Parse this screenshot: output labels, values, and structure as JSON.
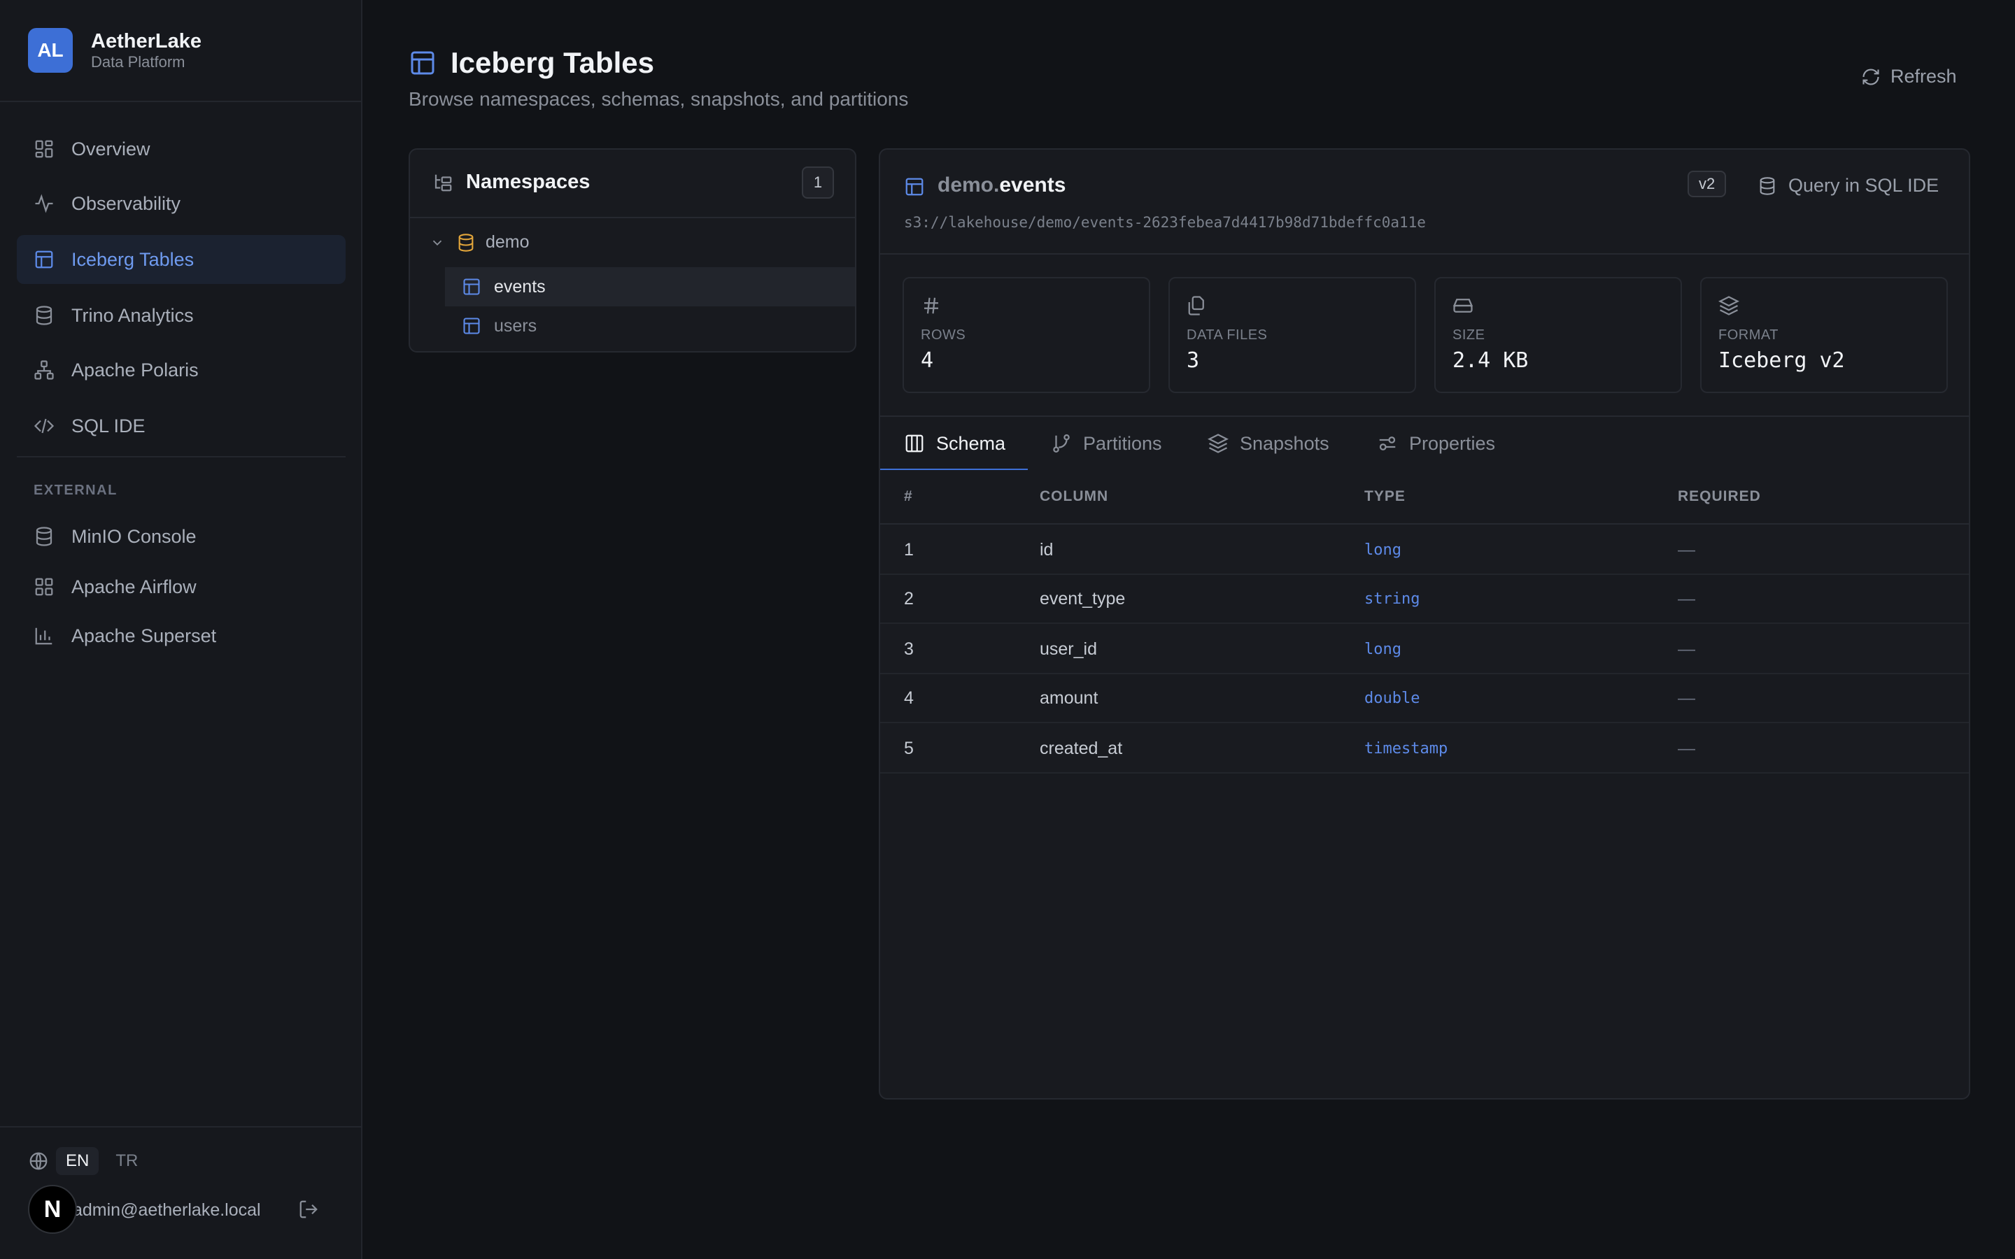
{
  "brand": {
    "logo": "AL",
    "name": "AetherLake",
    "subtitle": "Data Platform"
  },
  "nav": {
    "items": [
      {
        "label": "Overview",
        "icon": "grid-icon"
      },
      {
        "label": "Observability",
        "icon": "activity-icon"
      },
      {
        "label": "Iceberg Tables",
        "icon": "table-icon",
        "active": true
      },
      {
        "label": "Trino Analytics",
        "icon": "database-icon"
      },
      {
        "label": "Apache Polaris",
        "icon": "network-icon"
      },
      {
        "label": "SQL IDE",
        "icon": "code-icon"
      }
    ],
    "external_label": "EXTERNAL",
    "external": [
      {
        "label": "MinIO Console",
        "icon": "database-icon"
      },
      {
        "label": "Apache Airflow",
        "icon": "grid-icon"
      },
      {
        "label": "Apache Superset",
        "icon": "bar-chart-icon"
      }
    ]
  },
  "footer": {
    "languages": [
      "EN",
      "TR"
    ],
    "active_language": "EN",
    "user_email": "admin@aetherlake.local",
    "avatar_letter": "N"
  },
  "header": {
    "title": "Iceberg Tables",
    "subtitle": "Browse namespaces, schemas, snapshots, and partitions",
    "refresh_label": "Refresh"
  },
  "namespaces": {
    "title": "Namespaces",
    "count": "1",
    "tree": {
      "namespace": "demo",
      "tables": [
        "events",
        "users"
      ],
      "selected": "events"
    }
  },
  "table": {
    "namespace": "demo",
    "separator": ".",
    "name": "events",
    "location": "s3://lakehouse/demo/events-2623febea7d4417b98d71bdeffc0a11e",
    "version_badge": "v2",
    "query_label": "Query in SQL IDE",
    "stats": [
      {
        "label": "ROWS",
        "value": "4",
        "icon": "hash-icon"
      },
      {
        "label": "DATA FILES",
        "value": "3",
        "icon": "files-icon"
      },
      {
        "label": "SIZE",
        "value": "2.4 KB",
        "icon": "hard-drive-icon"
      },
      {
        "label": "FORMAT",
        "value": "Iceberg v2",
        "icon": "layers-icon"
      }
    ],
    "tabs": [
      {
        "label": "Schema",
        "icon": "columns-icon",
        "active": true
      },
      {
        "label": "Partitions",
        "icon": "git-branch-icon"
      },
      {
        "label": "Snapshots",
        "icon": "layers-icon"
      },
      {
        "label": "Properties",
        "icon": "sliders-icon"
      }
    ],
    "schema": {
      "headers": [
        "#",
        "COLUMN",
        "TYPE",
        "REQUIRED"
      ],
      "rows": [
        {
          "n": "1",
          "column": "id",
          "type": "long",
          "required": "—"
        },
        {
          "n": "2",
          "column": "event_type",
          "type": "string",
          "required": "—"
        },
        {
          "n": "3",
          "column": "user_id",
          "type": "long",
          "required": "—"
        },
        {
          "n": "4",
          "column": "amount",
          "type": "double",
          "required": "—"
        },
        {
          "n": "5",
          "column": "created_at",
          "type": "timestamp",
          "required": "—"
        }
      ]
    }
  },
  "colors": {
    "accent": "#3d6fd6",
    "namespace_icon": "#e3a63b",
    "background": "#111317"
  }
}
